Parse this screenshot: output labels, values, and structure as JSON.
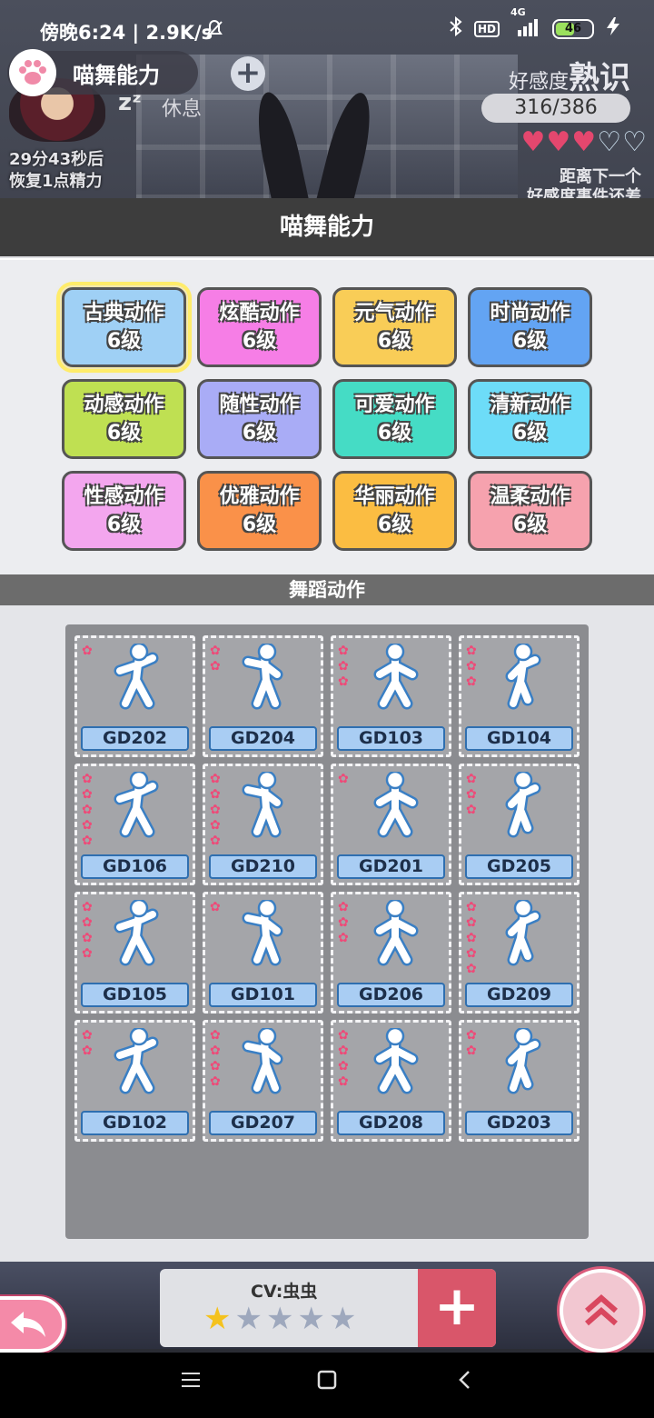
{
  "status_bar": {
    "time": "傍晚6:24 | 2.9K/s",
    "signal_label": "4G",
    "hd_label": "HD",
    "battery": "46"
  },
  "hud": {
    "title": "喵舞能力",
    "rest_label": "休息",
    "sleep_z": "zᶻ",
    "recover_line1": "29分43秒后",
    "recover_line2": "恢复1点精力",
    "favor_prefix": "好感度",
    "favor_level": "熟识",
    "favor_value": "316/386",
    "hearts_filled": 3,
    "hearts_total": 5,
    "next_favor_line1": "距离下一个",
    "next_favor_line2": "好感度事件还差"
  },
  "panel": {
    "title": "喵舞能力",
    "dance_section_title": "舞蹈动作"
  },
  "abilities": [
    {
      "name": "古典动作",
      "level": "6级",
      "color": "#9fd0f5",
      "selected": true
    },
    {
      "name": "炫酷动作",
      "level": "6级",
      "color": "#f67ee6",
      "selected": false
    },
    {
      "name": "元气动作",
      "level": "6级",
      "color": "#f9cd57",
      "selected": false
    },
    {
      "name": "时尚动作",
      "level": "6级",
      "color": "#63a4f3",
      "selected": false
    },
    {
      "name": "动感动作",
      "level": "6级",
      "color": "#bfe052",
      "selected": false
    },
    {
      "name": "随性动作",
      "level": "6级",
      "color": "#a9acf6",
      "selected": false
    },
    {
      "name": "可爱动作",
      "level": "6级",
      "color": "#45dcc5",
      "selected": false
    },
    {
      "name": "清新动作",
      "level": "6级",
      "color": "#6ddcf8",
      "selected": false
    },
    {
      "name": "性感动作",
      "level": "6级",
      "color": "#f3a6ee",
      "selected": false
    },
    {
      "name": "优雅动作",
      "level": "6级",
      "color": "#fa9149",
      "selected": false
    },
    {
      "name": "华丽动作",
      "level": "6级",
      "color": "#fbbd42",
      "selected": false
    },
    {
      "name": "温柔动作",
      "level": "6级",
      "color": "#f6a2ae",
      "selected": false
    }
  ],
  "moves": [
    {
      "code": "GD202",
      "stars": 1
    },
    {
      "code": "GD204",
      "stars": 2
    },
    {
      "code": "GD103",
      "stars": 3
    },
    {
      "code": "GD104",
      "stars": 3
    },
    {
      "code": "GD106",
      "stars": 5
    },
    {
      "code": "GD210",
      "stars": 5
    },
    {
      "code": "GD201",
      "stars": 1
    },
    {
      "code": "GD205",
      "stars": 3
    },
    {
      "code": "GD105",
      "stars": 4
    },
    {
      "code": "GD101",
      "stars": 1
    },
    {
      "code": "GD206",
      "stars": 3
    },
    {
      "code": "GD209",
      "stars": 5
    },
    {
      "code": "GD102",
      "stars": 2
    },
    {
      "code": "GD207",
      "stars": 4
    },
    {
      "code": "GD208",
      "stars": 4
    },
    {
      "code": "GD203",
      "stars": 2
    }
  ],
  "bottom": {
    "cv_label": "CV:虫虫",
    "cv_rating": 1,
    "cv_rating_max": 5,
    "plus_symbol": "+"
  },
  "colors": {
    "star_pink": "#ee4a78",
    "code_bg": "#a9cdf3",
    "panel_header": "#3d3d3d"
  },
  "icons": [
    "paw-icon",
    "plus-icon",
    "bluetooth-icon",
    "signal-icon",
    "battery-icon",
    "heart-icon",
    "back-arrow-icon",
    "double-chevron-up-icon",
    "menu-icon",
    "home-square-icon",
    "back-chevron-icon",
    "dancer-figure-icon",
    "star-icon"
  ]
}
